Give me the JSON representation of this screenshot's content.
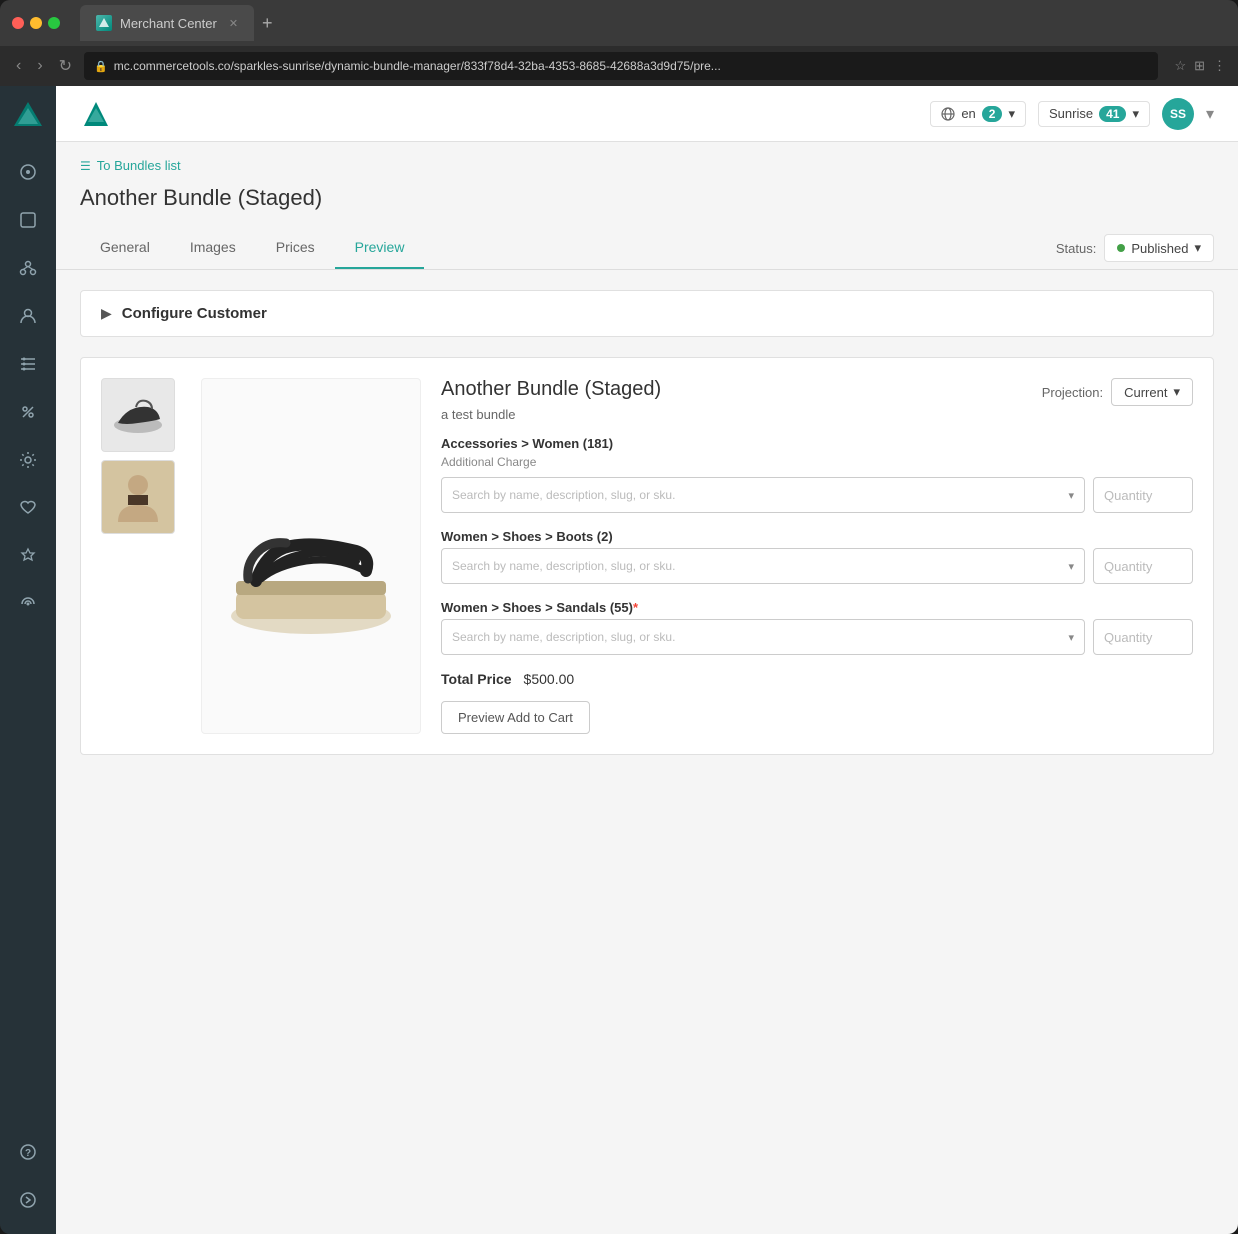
{
  "browser": {
    "tab_title": "Merchant Center",
    "url": "mc.commercetools.co/sparkles-sunrise/dynamic-bundle-manager/833f78d4-32ba-4353-8685-42688a3d9d75/pre...",
    "tab_plus": "+"
  },
  "header": {
    "lang": "en",
    "lang_badge": "2",
    "project": "Sunrise",
    "project_badge": "41",
    "user_initials": "SS"
  },
  "breadcrumb": {
    "icon": "☰",
    "text": "To Bundles list"
  },
  "page": {
    "title": "Another Bundle (Staged)",
    "status_label": "Status:",
    "status_value": "Published"
  },
  "tabs": {
    "items": [
      {
        "label": "General",
        "active": false
      },
      {
        "label": "Images",
        "active": false
      },
      {
        "label": "Prices",
        "active": false
      },
      {
        "label": "Preview",
        "active": true
      }
    ]
  },
  "configure": {
    "title": "Configure Customer"
  },
  "preview": {
    "product_title": "Another Bundle (Staged)",
    "product_subtitle": "a test bundle",
    "projection_label": "Projection:",
    "projection_value": "Current",
    "categories": [
      {
        "label": "Accessories > Women (181)",
        "sublabel": "Additional Charge",
        "required": false,
        "search_placeholder": "Search by name, description, slug, or sku.",
        "qty_placeholder": "Quantity"
      },
      {
        "label": "Women > Shoes > Boots (2)",
        "sublabel": "",
        "required": false,
        "search_placeholder": "Search by name, description, slug, or sku.",
        "qty_placeholder": "Quantity"
      },
      {
        "label": "Women > Shoes > Sandals (55)",
        "sublabel": "",
        "required": true,
        "search_placeholder": "Search by name, description, slug, or sku.",
        "qty_placeholder": "Quantity"
      }
    ],
    "total_price_label": "Total Price",
    "total_price_value": "$500.00",
    "preview_btn": "Preview Add to Cart"
  },
  "sidebar": {
    "items": [
      {
        "icon": "⊙",
        "name": "dashboard"
      },
      {
        "icon": "⬡",
        "name": "products"
      },
      {
        "icon": "⋱",
        "name": "categories"
      },
      {
        "icon": "👤",
        "name": "customers"
      },
      {
        "icon": "🛒",
        "name": "orders"
      },
      {
        "icon": "🏷",
        "name": "discounts"
      },
      {
        "icon": "⚙",
        "name": "settings"
      },
      {
        "icon": "♡",
        "name": "favorites"
      },
      {
        "icon": "🚀",
        "name": "extensions"
      },
      {
        "icon": "📎",
        "name": "integrations"
      }
    ],
    "bottom": [
      {
        "icon": "?",
        "name": "help"
      },
      {
        "icon": "→",
        "name": "collapse"
      }
    ]
  }
}
